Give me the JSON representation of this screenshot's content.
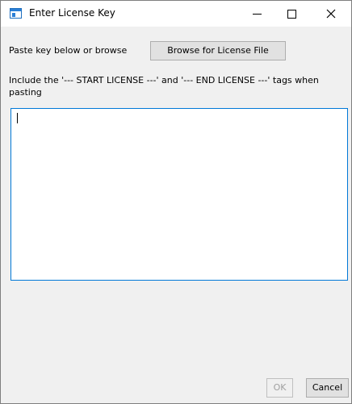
{
  "window": {
    "title": "Enter License Key",
    "icon": "app-window-icon",
    "controls": {
      "minimize_icon": "minimize-icon",
      "maximize_icon": "maximize-icon",
      "close_icon": "close-icon"
    }
  },
  "form": {
    "prompt_label": "Paste key below or browse",
    "browse_button_label": "Browse for License File",
    "instruction": "Include the '--- START LICENSE ---' and '--- END LICENSE ---' tags when pasting",
    "key_value": ""
  },
  "footer": {
    "ok_label": "OK",
    "ok_enabled": false,
    "cancel_label": "Cancel"
  },
  "colors": {
    "accent": "#0078d7",
    "window_background": "#f0f0f0",
    "button_face": "#e1e1e1",
    "disabled_text": "#a0a0a0"
  }
}
